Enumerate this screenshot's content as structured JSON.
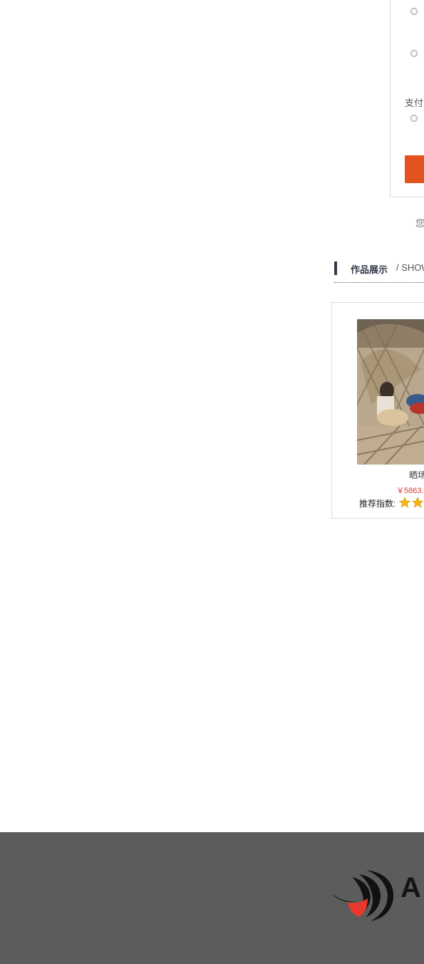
{
  "order": {
    "payment_label": "支付",
    "radio_options": [
      "",
      "",
      ""
    ],
    "submit_label": "",
    "note": "您"
  },
  "showcase": {
    "title": "作品展示",
    "subtitle": "/ SHOW",
    "product": {
      "name": "晒场",
      "price": "￥5863.",
      "rating_label": "推荐指数:",
      "rating_stars_visible": 2
    }
  },
  "footer": {
    "logo_text": "A"
  },
  "colors": {
    "accent": "#e2531f",
    "section_bar": "#333c4a",
    "price": "#d83a2f",
    "footer_bg": "#5d5c5d",
    "star": "#f5b50f"
  },
  "icons": {
    "radio": "radio-icon",
    "star": "star-icon",
    "logo": "bird-swirl-logo"
  }
}
